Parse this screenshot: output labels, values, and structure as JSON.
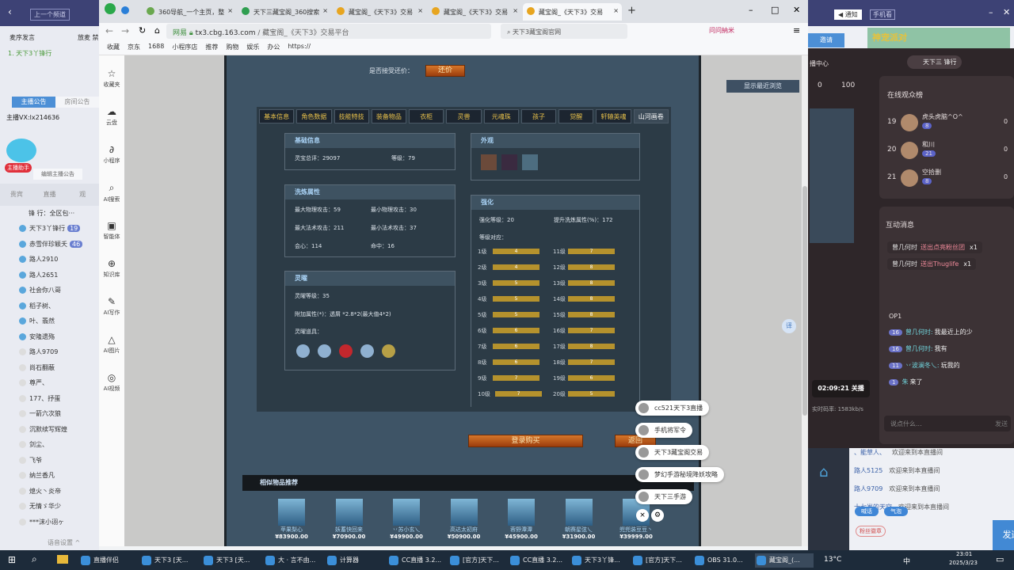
{
  "stream_left": {
    "prev_channel": "上一个频道",
    "mic_order": "麦序发言",
    "mic_ctrl": "放麦 禁",
    "queue_first": "1. 天下3丫锋行",
    "tabs": [
      "主播公告",
      "房间公告"
    ],
    "announcement": "主播VX:lx214636",
    "assistant_badge": "主播助手",
    "edit_announcement": "编辑主播公告",
    "seg_tabs": [
      "贵宾",
      "直播",
      "观"
    ],
    "rank_text": "锋 行：全区包···",
    "users": [
      "天下3丫锋行",
      "赤雪伴珍颖夭",
      "路人2910",
      "路人2651",
      "社会你八哥",
      "稻子树、",
      "叶、翡然",
      "安隆遗殇",
      "路人9709",
      "尚石翻蔽",
      "尊严、",
      "177、抒蛋",
      "一箭六次狼",
      "沉默续写辉煌",
      "剑尘、",
      "飞爷",
      "纳兰香凡",
      "熄火丶炎帝",
      "无情ゞ华少",
      "***沫小诩ヶ"
    ],
    "user_levels": {
      "0": "19",
      "1": "46"
    },
    "voice_settings": "语音设置 ^"
  },
  "browser": {
    "tabs": [
      {
        "label": "360导航_一个主页，整"
      },
      {
        "label": "天下三藏宝阁_360搜索"
      },
      {
        "label": "藏宝阁_《天下3》交易"
      },
      {
        "label": "藏宝阁_《天下3》交易"
      },
      {
        "label": "藏宝阁_《天下3》交易"
      }
    ],
    "new_tab": "+",
    "security_badge": "网易",
    "url_host": "tx3.cbg.163.com",
    "url_title": "/ 藏宝阁_《天下3》交易平台",
    "search_value": "天下3藏宝阁官网",
    "ext_label": "问问納米",
    "bookmarks": [
      "收藏",
      "京东",
      "1688",
      "小程序店",
      "推荐",
      "购物",
      "娱乐",
      "办公",
      "https://"
    ],
    "sidebar": [
      "收藏夹",
      "云盘",
      "小程序",
      "AI搜索",
      "智能体",
      "知识库",
      "AI写作",
      "AI图片",
      "AI视频"
    ]
  },
  "page": {
    "counter_offer_label": "是否接受还价：",
    "counter_offer_btn": "还价",
    "recent_btn": "显示最近浏览",
    "tabs": [
      "基本信息",
      "角色数据",
      "技能特技",
      "装备物品",
      "衣柜",
      "灵兽",
      "元魂珠",
      "孩子",
      "觉醒",
      "轩辕英魂",
      "山河画卷"
    ],
    "active_tab": "山河画卷",
    "basic": {
      "title": "基础信息",
      "score_label": "灵宝总评：",
      "score": "29097",
      "level_label": "等级：",
      "level": "79"
    },
    "refine": {
      "title": "洗炼属性",
      "rows": [
        [
          "最大物理攻击：",
          "59",
          "最小物理攻击：",
          "30"
        ],
        [
          "最大法术攻击：",
          "211",
          "最小法术攻击：",
          "37"
        ],
        [
          "会心：",
          "114",
          "命中：",
          "16"
        ]
      ]
    },
    "lingyao": {
      "title": "灵曜",
      "level_label": "灵曜等级：",
      "level": "35",
      "extra_label": "附加属性(*)：",
      "extra": "透屑 *2.8*2(最大值4*2)",
      "items_label": "灵曜道具："
    },
    "appearance": {
      "title": "外观"
    },
    "strengthen": {
      "title": "强化",
      "level_label": "强化等级：",
      "level": "20",
      "bonus_label": "提升洗炼属性(%)：",
      "bonus": "172",
      "map_label": "等级对应：",
      "levels": [
        {
          "lv": "1级",
          "v": 4
        },
        {
          "lv": "2级",
          "v": 4
        },
        {
          "lv": "3级",
          "v": 5
        },
        {
          "lv": "4级",
          "v": 5
        },
        {
          "lv": "5级",
          "v": 5
        },
        {
          "lv": "6级",
          "v": 6
        },
        {
          "lv": "7级",
          "v": 6
        },
        {
          "lv": "8级",
          "v": 6
        },
        {
          "lv": "9级",
          "v": 7
        },
        {
          "lv": "10级",
          "v": 7
        },
        {
          "lv": "11级",
          "v": 7
        },
        {
          "lv": "12级",
          "v": 8
        },
        {
          "lv": "13级",
          "v": 8
        },
        {
          "lv": "14级",
          "v": 8
        },
        {
          "lv": "15级",
          "v": 8
        },
        {
          "lv": "16级",
          "v": 7
        },
        {
          "lv": "17级",
          "v": 8
        },
        {
          "lv": "18级",
          "v": 7
        },
        {
          "lv": "19级",
          "v": 6
        },
        {
          "lv": "20级",
          "v": 5
        }
      ]
    },
    "login_buy": "登录购买",
    "back": "返回",
    "recommend_title": "相似物品推荐",
    "recommend": [
      {
        "name": "苹果梨心",
        "price": "¥83900.00"
      },
      {
        "name": "妖蓄快回来",
        "price": "¥70900.00"
      },
      {
        "name": "丷苏小玄乀",
        "price": "¥49900.00"
      },
      {
        "name": "高达太初府",
        "price": "¥50900.00"
      },
      {
        "name": "蓉野潭潭",
        "price": "¥45900.00"
      },
      {
        "name": "朝赛星弦乀",
        "price": "¥31900.00"
      },
      {
        "name": "兜兜装豆豆丶",
        "price": "¥39999.00"
      }
    ],
    "float_chips": [
      "cc521天下3直播",
      "手机将军令",
      "天下3藏宝阁交易",
      "梦幻手游秘境降妖攻略",
      "天下三手游"
    ],
    "translate": "译"
  },
  "stream_right": {
    "notice": "◀ 通知",
    "phone": "手机看",
    "invite": "邀请",
    "banner": "神宠派对",
    "user": "天下三 锋行",
    "center": "播中心",
    "coins": "0",
    "gifts": "100",
    "audience_title": "在线观众榜",
    "audience": [
      {
        "rank": "19",
        "name": "虎头虎脑^O^",
        "lv": "8",
        "val": "0"
      },
      {
        "rank": "20",
        "name": "和川",
        "lv": "21",
        "val": "0"
      },
      {
        "rank": "21",
        "name": "空拾删",
        "lv": "8",
        "val": "0"
      }
    ],
    "interact_title": "互动消息",
    "gifts_msgs": [
      {
        "user": "曾几何时",
        "act": "送出点亮粉丝团",
        "count": "x1"
      },
      {
        "user": "曾几何时",
        "act": "送出Thuglife",
        "count": "x1"
      }
    ],
    "op": "OP1",
    "chat": [
      {
        "lv": "16",
        "user": "曾几何时:",
        "msg": "我最近上的少"
      },
      {
        "lv": "16",
        "user": "曾几何时:",
        "msg": "我有"
      },
      {
        "lv": "11",
        "user": "丷波澜冬乀:",
        "msg": "玩我的"
      },
      {
        "lv": "1",
        "user": "朱",
        "msg": "来了"
      }
    ],
    "timer": "02:09:21 关播",
    "bitrate": "实时码率: 1583kb/s",
    "input_ph": "说点什么...",
    "send_small": "发送",
    "welcome": [
      {
        "user": "、能草人、",
        "msg": "欢迎来到本直播间"
      },
      {
        "user": "路人5125",
        "msg": "欢迎来到本直播间"
      },
      {
        "user": "路人9709",
        "msg": "欢迎来到本直播间"
      },
      {
        "user": "十七岁的天空",
        "msg": "欢迎来到本直播间"
      }
    ],
    "pill1": "喊话",
    "pill2": "气泡",
    "fan_badge": "粉丝徽章",
    "send": "发送"
  },
  "taskbar": {
    "items": [
      "直播伴侣",
      "天下3 [天...",
      "天下3 [天...",
      "大 · 言不由...",
      "计算器",
      "CC直播 3.2...",
      "[官方]天下...",
      "CC直播 3.2...",
      "天下3丫锋...",
      "[官方]天下...",
      "OBS 31.0...",
      "藏宝阁_(..."
    ],
    "weather": "13°C",
    "ime": "中",
    "time": "23:01",
    "date": "2025/3/23"
  }
}
